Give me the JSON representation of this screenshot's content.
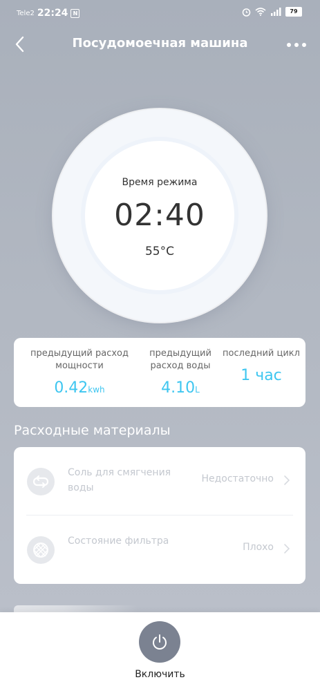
{
  "status_bar": {
    "carrier": "Tele2",
    "time": "22:24",
    "nfc": "N",
    "battery": "79"
  },
  "header": {
    "title": "Посудомоечная машина"
  },
  "dial": {
    "label": "Время режима",
    "time": "02:40",
    "temperature": "55°C"
  },
  "stats": [
    {
      "label": "предыдущий расход мощности",
      "value": "0.42",
      "unit": "kwh"
    },
    {
      "label": "предыдущий расход воды",
      "value": "4.10",
      "unit": "L"
    },
    {
      "label": "последний цикл",
      "value": "1 час",
      "unit": ""
    }
  ],
  "consumables": {
    "title": "Расходные материалы",
    "items": [
      {
        "label": "Соль для смягчения воды",
        "value": "Недостаточно",
        "icon": "salt-icon"
      },
      {
        "label": "Состояние фильтра",
        "value": "Плохо",
        "icon": "filter-icon"
      }
    ]
  },
  "bottom": {
    "power_label": "Включить"
  },
  "colors": {
    "accent": "#3ec6f0",
    "power_button": "#7b8291"
  }
}
